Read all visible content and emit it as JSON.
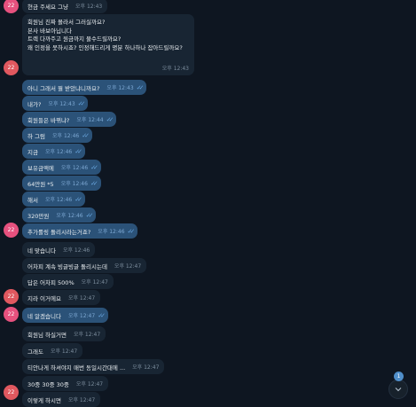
{
  "avatar_label": "22",
  "first_message": {
    "text": "현금 주세요 그냥",
    "time": "오후 12:43"
  },
  "long_message": {
    "lines": [
      "회원님 진짜 몰라서 그러실까요?",
      "본사 바보아닙니다",
      "",
      "트렉 다까주고 원금까지 물수드릴까요?",
      "",
      "왜 인정을 못하시죠? 인정해드리게 명분 하나하나 잡아드릴까요?"
    ],
    "time": "오후 12:43"
  },
  "messages": [
    {
      "text": "아니 그래서 뭘 받았냐니까요?",
      "time": "오후 12:43"
    },
    {
      "text": "내가?",
      "time": "오후 12:43"
    },
    {
      "text": "회원들은 바뀌냐?",
      "time": "오후 12:44"
    },
    {
      "text": "하 그럼",
      "time": "오후 12:46"
    },
    {
      "text": "지금",
      "time": "오후 12:46"
    },
    {
      "text": "보유금액에",
      "time": "오후 12:46"
    },
    {
      "text": "64만원 *5",
      "time": "오후 12:46"
    },
    {
      "text": "해서",
      "time": "오후 12:46"
    },
    {
      "text": "320만원",
      "time": "오후 12:46"
    },
    {
      "text": "추가롤링 돌리시라는거죠?",
      "time": "오후 12:46"
    },
    {
      "text": "네 맞습니다",
      "time": "오후 12:46"
    },
    {
      "text": "어차피 계속 빙글빙글 돌리시는데",
      "time": "오후 12:47"
    },
    {
      "text": "답은 어차피 500%",
      "time": "오후 12:47"
    },
    {
      "text": "지라 이거에요",
      "time": "오후 12:47"
    },
    {
      "text": "네 알겠습니다",
      "time": "오후 12:47"
    },
    {
      "text": "회원님 하실거면",
      "time": "오후 12:47"
    },
    {
      "text": "그래도",
      "time": "오후 12:47"
    },
    {
      "text": "티안나게 하셔야지 매번 동일시간대에 ...",
      "time": "오후 12:47"
    },
    {
      "text": "30중 30중 30중",
      "time": "오후 12:47"
    },
    {
      "text": "이렇게 하시면",
      "time": "오후 12:47"
    }
  ],
  "unread_count": "1",
  "colors": {
    "background": "#0e1621",
    "outgoing": "#2b5278",
    "incoming": "#182533",
    "checks": "#6aa7e0"
  },
  "icons": [
    "double-check-icon",
    "chevron-down-icon"
  ]
}
